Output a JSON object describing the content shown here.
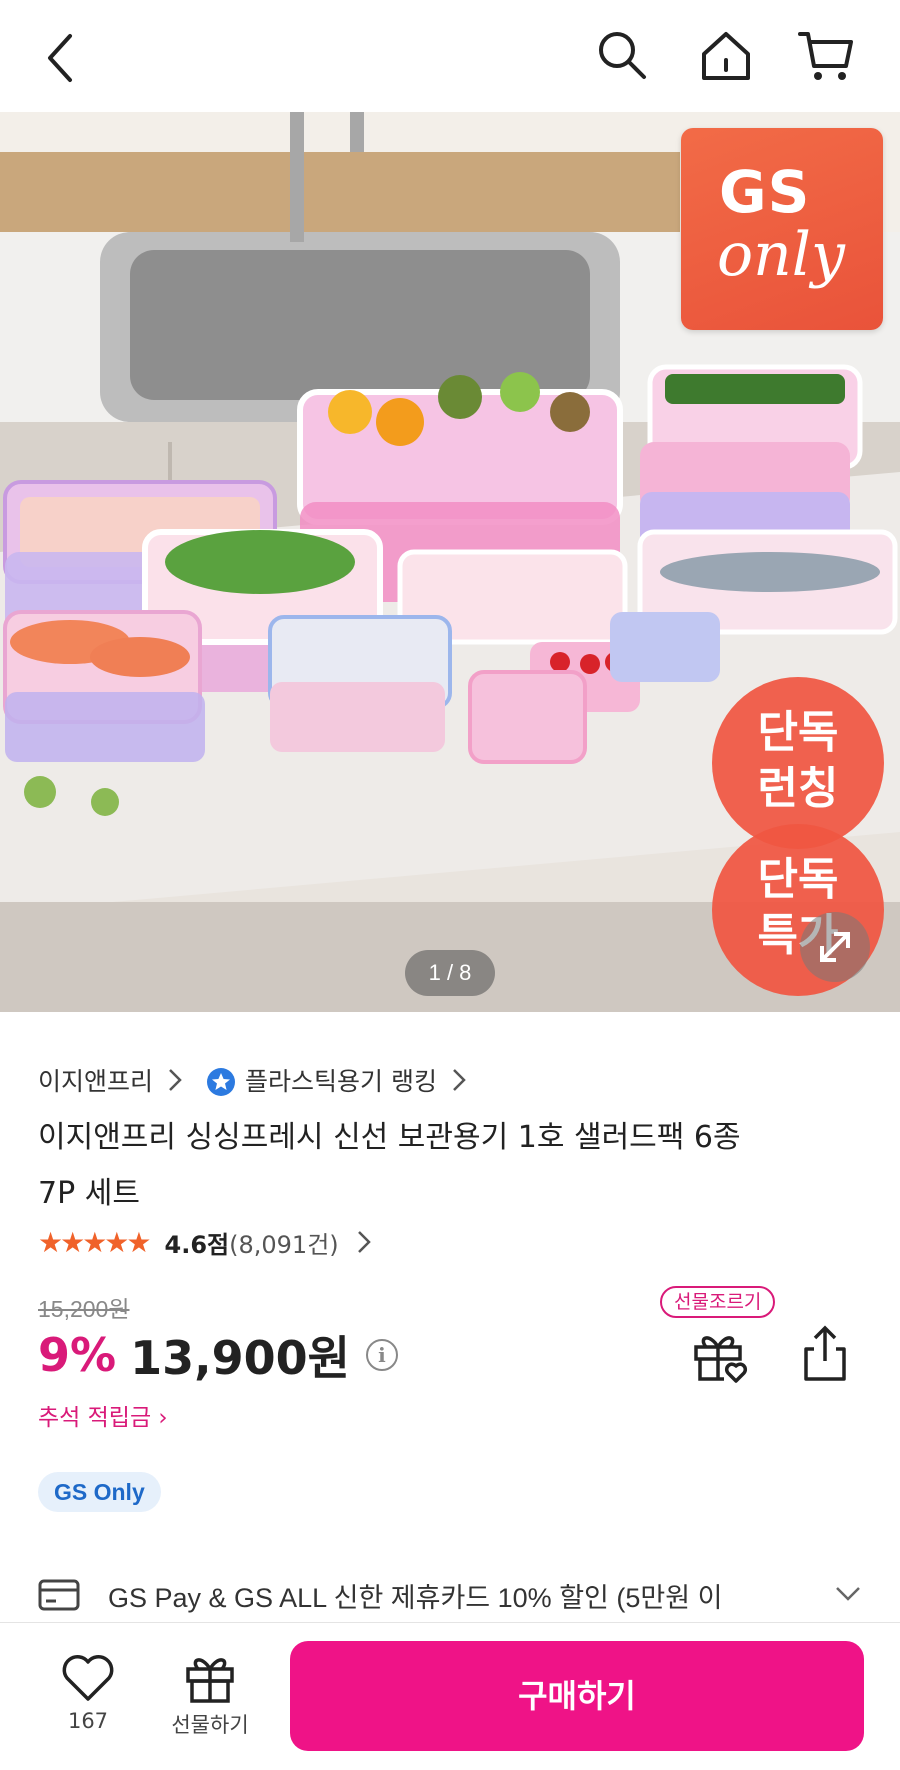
{
  "header": {
    "back": "chevron-left-icon",
    "search": "search-icon",
    "home": "home-icon",
    "cart": "cart-icon"
  },
  "hero": {
    "badge_line1": "GS",
    "badge_line2": "only",
    "exclusive_launch": [
      "단독",
      "런칭"
    ],
    "exclusive_deal": [
      "단독",
      "특가"
    ],
    "image_counter": "1 / 8",
    "expand_icon": "expand-icon"
  },
  "product": {
    "brand": "이지앤프리",
    "ranking": "플라스틱용기 랭킹",
    "title_line1": "이지앤프리 싱싱프레시 신선 보관용기 1호 샐러드팩 6종",
    "title_line2": "7P 세트",
    "rating_stars": 4.6,
    "rating_score": "4.6점",
    "review_count": "(8,091건)",
    "original_price": "15,200원",
    "discount": "9%",
    "price": "13,900원",
    "gift_tag": "선물조르기",
    "event": "추석 적립금 ›",
    "gs_pill": "GS Only",
    "card_promo": "GS Pay & GS ALL 신한 제휴카드 10% 할인 (5만원 이"
  },
  "bottom": {
    "like_count": "167",
    "gift_label": "선물하기",
    "buy_label": "구매하기"
  },
  "colors": {
    "accent": "#ef1387",
    "discount": "#d91a79",
    "badge": "#f05642",
    "star": "#f0622a",
    "pill_text": "#1e69c8"
  }
}
